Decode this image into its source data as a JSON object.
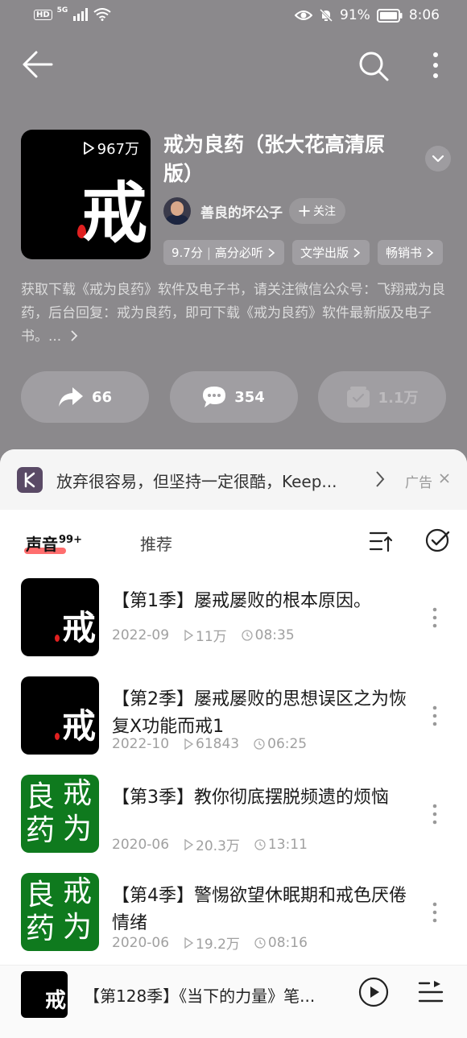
{
  "status_bar": {
    "left_labels": [
      "HD",
      "5G"
    ],
    "battery": "91%",
    "time": "8:06"
  },
  "nav": {
    "back_icon": "back-arrow-icon",
    "search_icon": "search-icon",
    "more_icon": "more-vertical-icon"
  },
  "album": {
    "cover_plays": "967万",
    "cover_char": "戒",
    "title": "戒为良药（张大花高清原版）",
    "author": "善良的坏公子",
    "follow_label": "关注",
    "tags": [
      {
        "score": "9.7分",
        "label": "高分必听"
      },
      {
        "label": "文学出版"
      },
      {
        "label": "畅销书"
      }
    ],
    "description": "获取下载《戒为良药》软件及电子书，请关注微信公众号：飞翔戒为良药，后台回复：戒为良药，即可下载《戒为良药》软件最新版及电子书。..."
  },
  "actions": {
    "share_count": "66",
    "comment_count": "354",
    "subscribe_count": "1.1万"
  },
  "ad": {
    "text": "放弃很容易，但坚持一定很酷，Keep...",
    "label": "广告"
  },
  "tabs": {
    "sound": "声音",
    "sound_badge": "99+",
    "recommend": "推荐"
  },
  "episodes": [
    {
      "title": "【第1季】屡戒屡败的根本原因。",
      "date": "2022-09",
      "plays": "11万",
      "duration": "08:35",
      "thumb": "black"
    },
    {
      "title": "【第2季】屡戒屡败的思想误区之为恢复X功能而戒1",
      "date": "2022-10",
      "plays": "61843",
      "duration": "06:25",
      "thumb": "black"
    },
    {
      "title": "【第3季】教你彻底摆脱频遗的烦恼",
      "date": "2020-06",
      "plays": "20.3万",
      "duration": "13:11",
      "thumb": "green"
    },
    {
      "title": "【第4季】警惕欲望休眠期和戒色厌倦情绪",
      "date": "2020-06",
      "plays": "19.2万",
      "duration": "08:16",
      "thumb": "green"
    }
  ],
  "thumb_chars": {
    "black": "戒",
    "green": [
      "良",
      "戒",
      "药",
      "为"
    ]
  },
  "player": {
    "title": "【第128季】《当下的力量》笔...",
    "thumb_char": "戒"
  },
  "colors": {
    "hero_bg": "#8b898c",
    "accent_underline": "#ff5555",
    "green_cover": "#0f7a1e"
  }
}
